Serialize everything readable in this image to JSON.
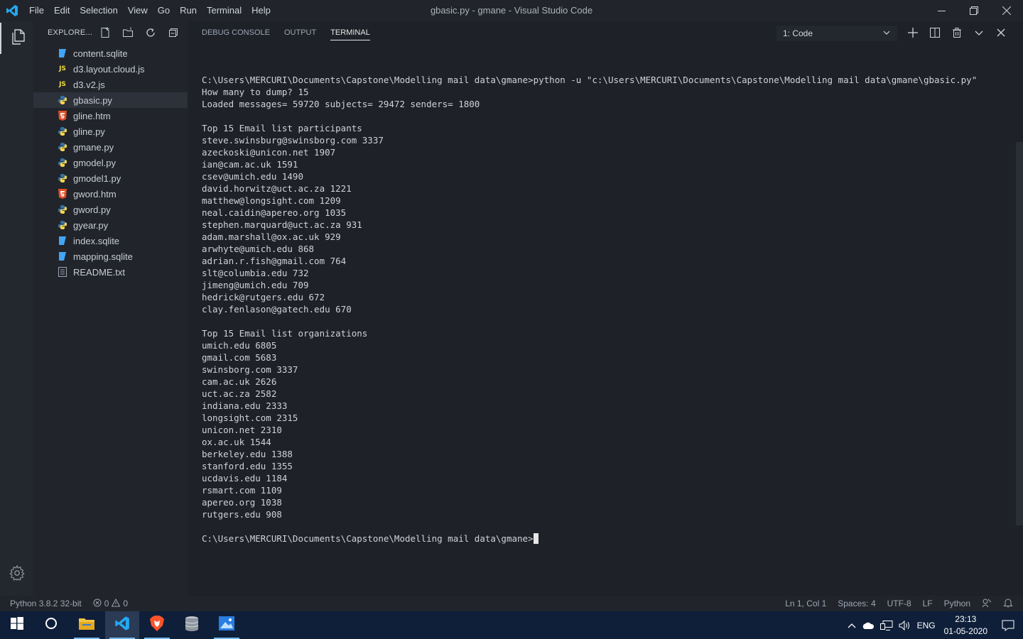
{
  "window": {
    "title": "gbasic.py - gmane - Visual Studio Code",
    "menu": [
      "File",
      "Edit",
      "Selection",
      "View",
      "Go",
      "Run",
      "Terminal",
      "Help"
    ]
  },
  "sidebar": {
    "header": "EXPLORE...",
    "files": [
      {
        "name": "content.sqlite",
        "icon": "database-icon",
        "active": false
      },
      {
        "name": "d3.layout.cloud.js",
        "icon": "js-icon",
        "active": false
      },
      {
        "name": "d3.v2.js",
        "icon": "js-icon",
        "active": false
      },
      {
        "name": "gbasic.py",
        "icon": "python-icon",
        "active": true
      },
      {
        "name": "gline.htm",
        "icon": "html5-icon",
        "active": false
      },
      {
        "name": "gline.py",
        "icon": "python-icon",
        "active": false
      },
      {
        "name": "gmane.py",
        "icon": "python-icon",
        "active": false
      },
      {
        "name": "gmodel.py",
        "icon": "python-icon",
        "active": false
      },
      {
        "name": "gmodel1.py",
        "icon": "python-icon",
        "active": false
      },
      {
        "name": "gword.htm",
        "icon": "html5-icon",
        "active": false
      },
      {
        "name": "gword.py",
        "icon": "python-icon",
        "active": false
      },
      {
        "name": "gyear.py",
        "icon": "python-icon",
        "active": false
      },
      {
        "name": "index.sqlite",
        "icon": "database-icon",
        "active": false
      },
      {
        "name": "mapping.sqlite",
        "icon": "database-icon",
        "active": false
      },
      {
        "name": "README.txt",
        "icon": "text-file-icon",
        "active": false
      }
    ]
  },
  "panel": {
    "tabs": [
      "DEBUG CONSOLE",
      "OUTPUT",
      "TERMINAL"
    ],
    "active_tab": "TERMINAL",
    "terminal_selector": "1: Code",
    "terminal_lines": [
      "C:\\Users\\MERCURI\\Documents\\Capstone\\Modelling mail data\\gmane>python -u \"c:\\Users\\MERCURI\\Documents\\Capstone\\Modelling mail data\\gmane\\gbasic.py\"",
      "How many to dump? 15",
      "Loaded messages= 59720 subjects= 29472 senders= 1800",
      "",
      "Top 15 Email list participants",
      "steve.swinsburg@swinsborg.com 3337",
      "azeckoski@unicon.net 1907",
      "ian@cam.ac.uk 1591",
      "csev@umich.edu 1490",
      "david.horwitz@uct.ac.za 1221",
      "matthew@longsight.com 1209",
      "neal.caidin@apereo.org 1035",
      "stephen.marquard@uct.ac.za 931",
      "adam.marshall@ox.ac.uk 929",
      "arwhyte@umich.edu 868",
      "adrian.r.fish@gmail.com 764",
      "slt@columbia.edu 732",
      "jimeng@umich.edu 709",
      "hedrick@rutgers.edu 672",
      "clay.fenlason@gatech.edu 670",
      "",
      "Top 15 Email list organizations",
      "umich.edu 6805",
      "gmail.com 5683",
      "swinsborg.com 3337",
      "cam.ac.uk 2626",
      "uct.ac.za 2582",
      "indiana.edu 2333",
      "longsight.com 2315",
      "unicon.net 2310",
      "ox.ac.uk 1544",
      "berkeley.edu 1388",
      "stanford.edu 1355",
      "ucdavis.edu 1184",
      "rsmart.com 1109",
      "apereo.org 1038",
      "rutgers.edu 908",
      ""
    ],
    "prompt": "C:\\Users\\MERCURI\\Documents\\Capstone\\Modelling mail data\\gmane>"
  },
  "statusbar": {
    "interpreter": "Python 3.8.2 32-bit",
    "errors": "0",
    "warnings": "0",
    "position": "Ln 1, Col 1",
    "spaces": "Spaces: 4",
    "encoding": "UTF-8",
    "eol": "LF",
    "language": "Python"
  },
  "taskbar": {
    "language": "ENG",
    "time": "23:13",
    "date": "01-05-2020"
  },
  "colors": {
    "accent": "#007acc",
    "python_blue": "#3572a5",
    "python_yellow": "#f7d44c",
    "js_yellow": "#f1dd3f",
    "html_orange": "#e44d26",
    "db_blue": "#42a5f5"
  }
}
